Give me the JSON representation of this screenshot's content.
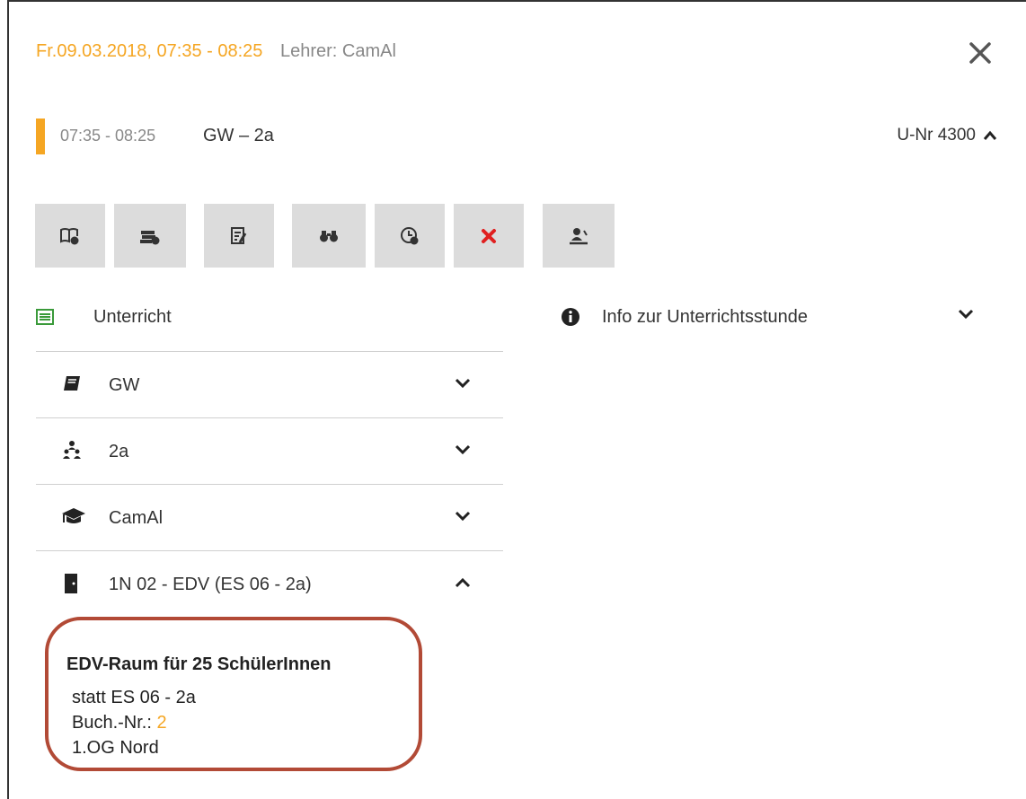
{
  "header": {
    "date_time": "Fr.09.03.2018, 07:35 - 08:25",
    "teacher": "Lehrer: CamAl"
  },
  "lesson": {
    "time": "07:35 - 08:25",
    "title": "GW – 2a",
    "unr": "U-Nr 4300"
  },
  "toolbar": [
    {
      "icon": "book-info-icon"
    },
    {
      "icon": "books-info-icon"
    },
    {
      "icon": "edit-note-icon"
    },
    {
      "icon": "binoculars-icon"
    },
    {
      "icon": "clock-add-icon"
    },
    {
      "icon": "cancel-x-icon"
    },
    {
      "icon": "substitute-person-icon"
    }
  ],
  "section": {
    "label": "Unterricht"
  },
  "info": {
    "label": "Info zur Unterrichtsstunde"
  },
  "rows": [
    {
      "label": "GW",
      "icon": "book-icon",
      "expanded": false
    },
    {
      "label": "2a",
      "icon": "class-group-icon",
      "expanded": false
    },
    {
      "label": "CamAl",
      "icon": "graduation-cap-icon",
      "expanded": false
    },
    {
      "label": "1N 02 - EDV (ES 06 - 2a)",
      "icon": "door-icon",
      "expanded": true
    }
  ],
  "room_detail": {
    "title": "EDV-Raum für 25 SchülerInnen",
    "instead": "statt ES 06 - 2a",
    "booking_label": "Buch.-Nr.:",
    "booking_number": "2",
    "location": "1.OG Nord"
  },
  "colors": {
    "accent": "#f5a623",
    "highlight_border": "#b24a36",
    "cancel": "#e02020"
  }
}
